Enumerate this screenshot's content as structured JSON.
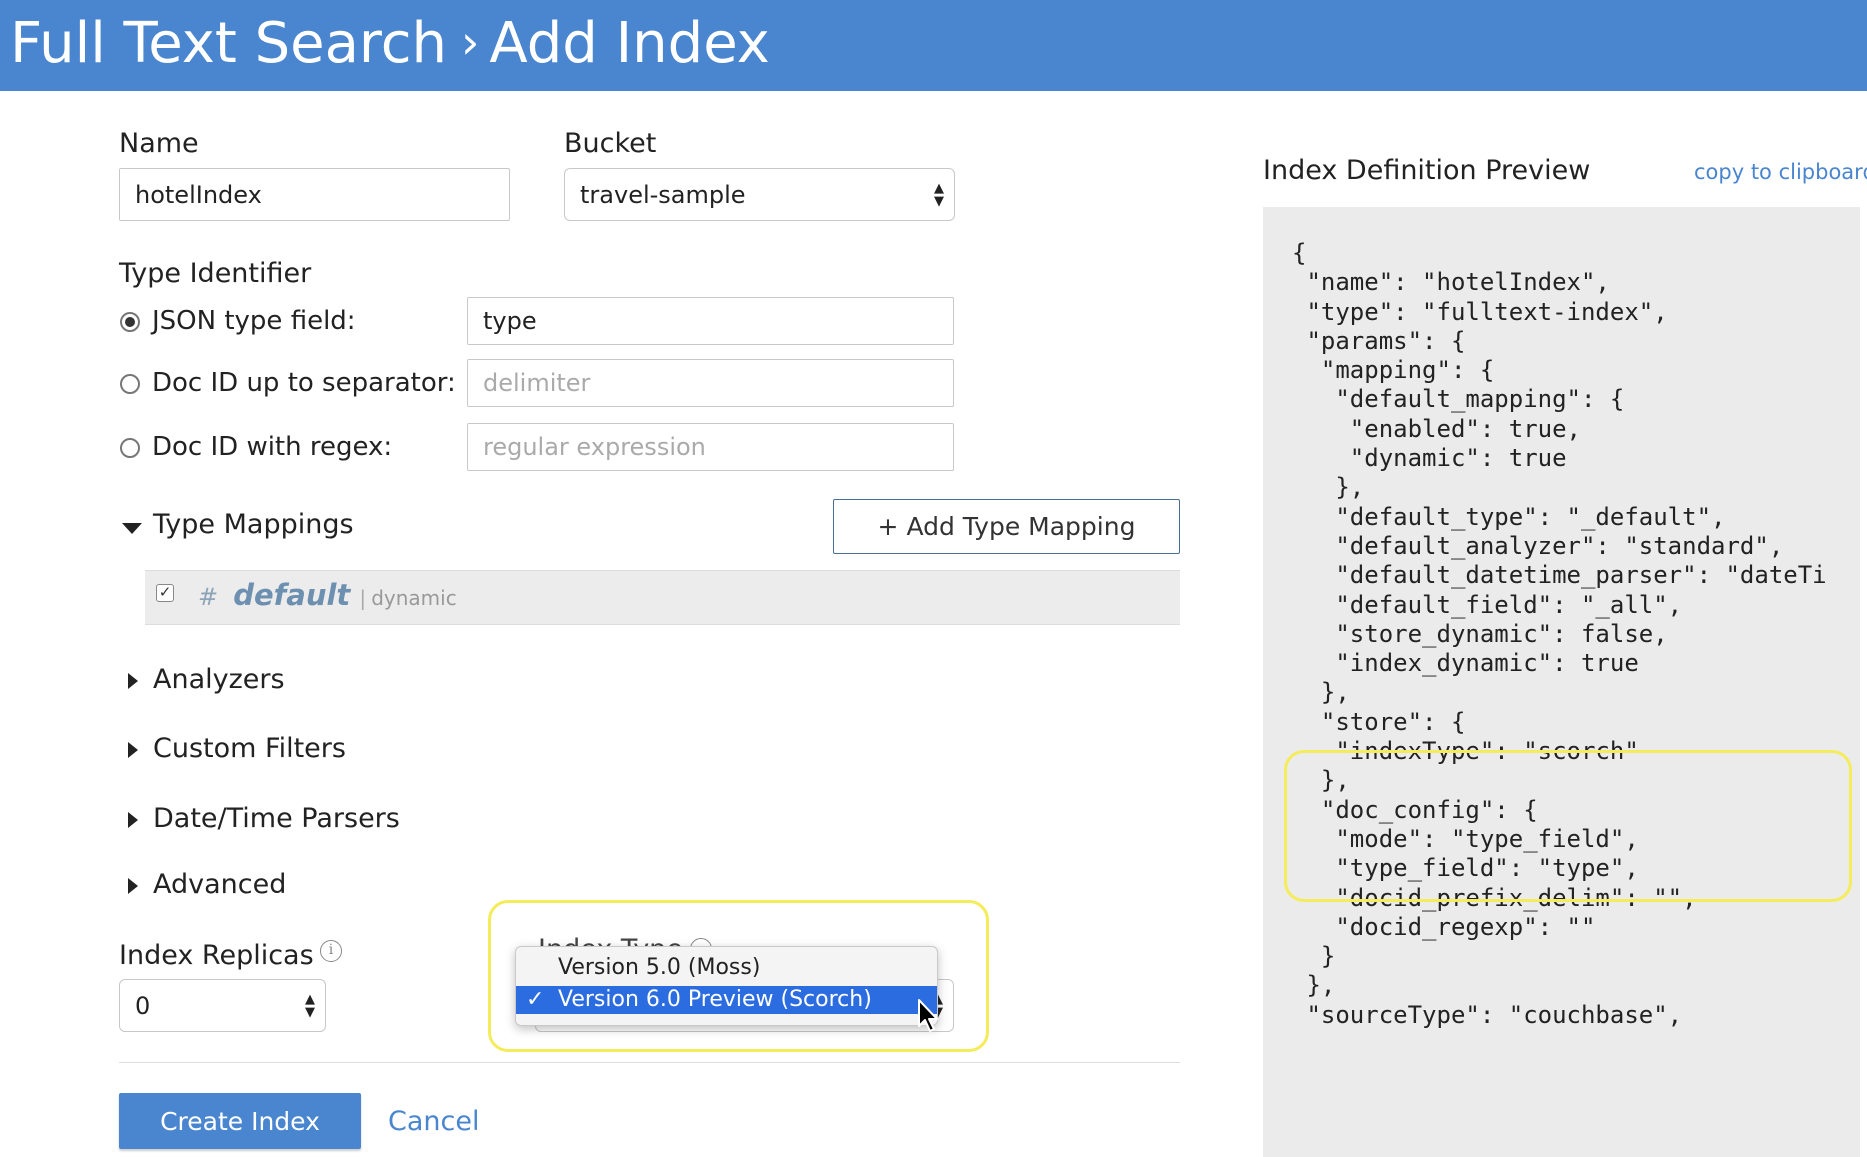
{
  "header": {
    "section": "Full Text Search",
    "separator": "›",
    "page": "Add Index"
  },
  "form": {
    "name_label": "Name",
    "name_value": "hotelIndex",
    "bucket_label": "Bucket",
    "bucket_value": "travel-sample",
    "type_identifier_label": "Type Identifier",
    "type_options": [
      {
        "label": "JSON type field:",
        "value": "type",
        "placeholder": "",
        "selected": true
      },
      {
        "label": "Doc ID up to separator:",
        "value": "",
        "placeholder": "delimiter",
        "selected": false
      },
      {
        "label": "Doc ID with regex:",
        "value": "",
        "placeholder": "regular expression",
        "selected": false
      }
    ],
    "type_mappings_label": "Type Mappings",
    "add_type_mapping_label": "+ Add Type Mapping",
    "mapping_row": {
      "hash": "#",
      "name": "default",
      "divider": "|",
      "mode": "dynamic"
    },
    "collapsed_sections": [
      "Analyzers",
      "Custom Filters",
      "Date/Time Parsers",
      "Advanced"
    ],
    "index_replicas_label": "Index Replicas",
    "index_replicas_value": "0",
    "info_icon_glyph": "i",
    "index_type_label": "Index Type",
    "index_type_options": [
      {
        "label": "Version 5.0 (Moss)",
        "selected": false
      },
      {
        "label": "Version 6.0 Preview (Scorch)",
        "selected": true
      }
    ],
    "create_button_label": "Create Index",
    "cancel_label": "Cancel"
  },
  "preview": {
    "title": "Index Definition Preview",
    "copy_label": "copy to clipboard",
    "lines": [
      "{",
      " \"name\": \"hotelIndex\",",
      " \"type\": \"fulltext-index\",",
      " \"params\": {",
      "  \"mapping\": {",
      "   \"default_mapping\": {",
      "    \"enabled\": true,",
      "    \"dynamic\": true",
      "   },",
      "   \"default_type\": \"_default\",",
      "   \"default_analyzer\": \"standard\",",
      "   \"default_datetime_parser\": \"dateTi",
      "   \"default_field\": \"_all\",",
      "   \"store_dynamic\": false,",
      "   \"index_dynamic\": true",
      "  },",
      "  \"store\": {",
      "   \"indexType\": \"scorch\"",
      "  },",
      "  \"doc_config\": {",
      "   \"mode\": \"type_field\",",
      "   \"type_field\": \"type\",",
      "   \"docid_prefix_delim\": \"\",",
      "   \"docid_regexp\": \"\"",
      "  }",
      " },",
      " \"sourceType\": \"couchbase\","
    ]
  },
  "colors": {
    "header_bg": "#4a86cf",
    "accent": "#4a86cf",
    "highlight": "#f4ec5a",
    "dropdown_selected": "#2b6ce0"
  }
}
